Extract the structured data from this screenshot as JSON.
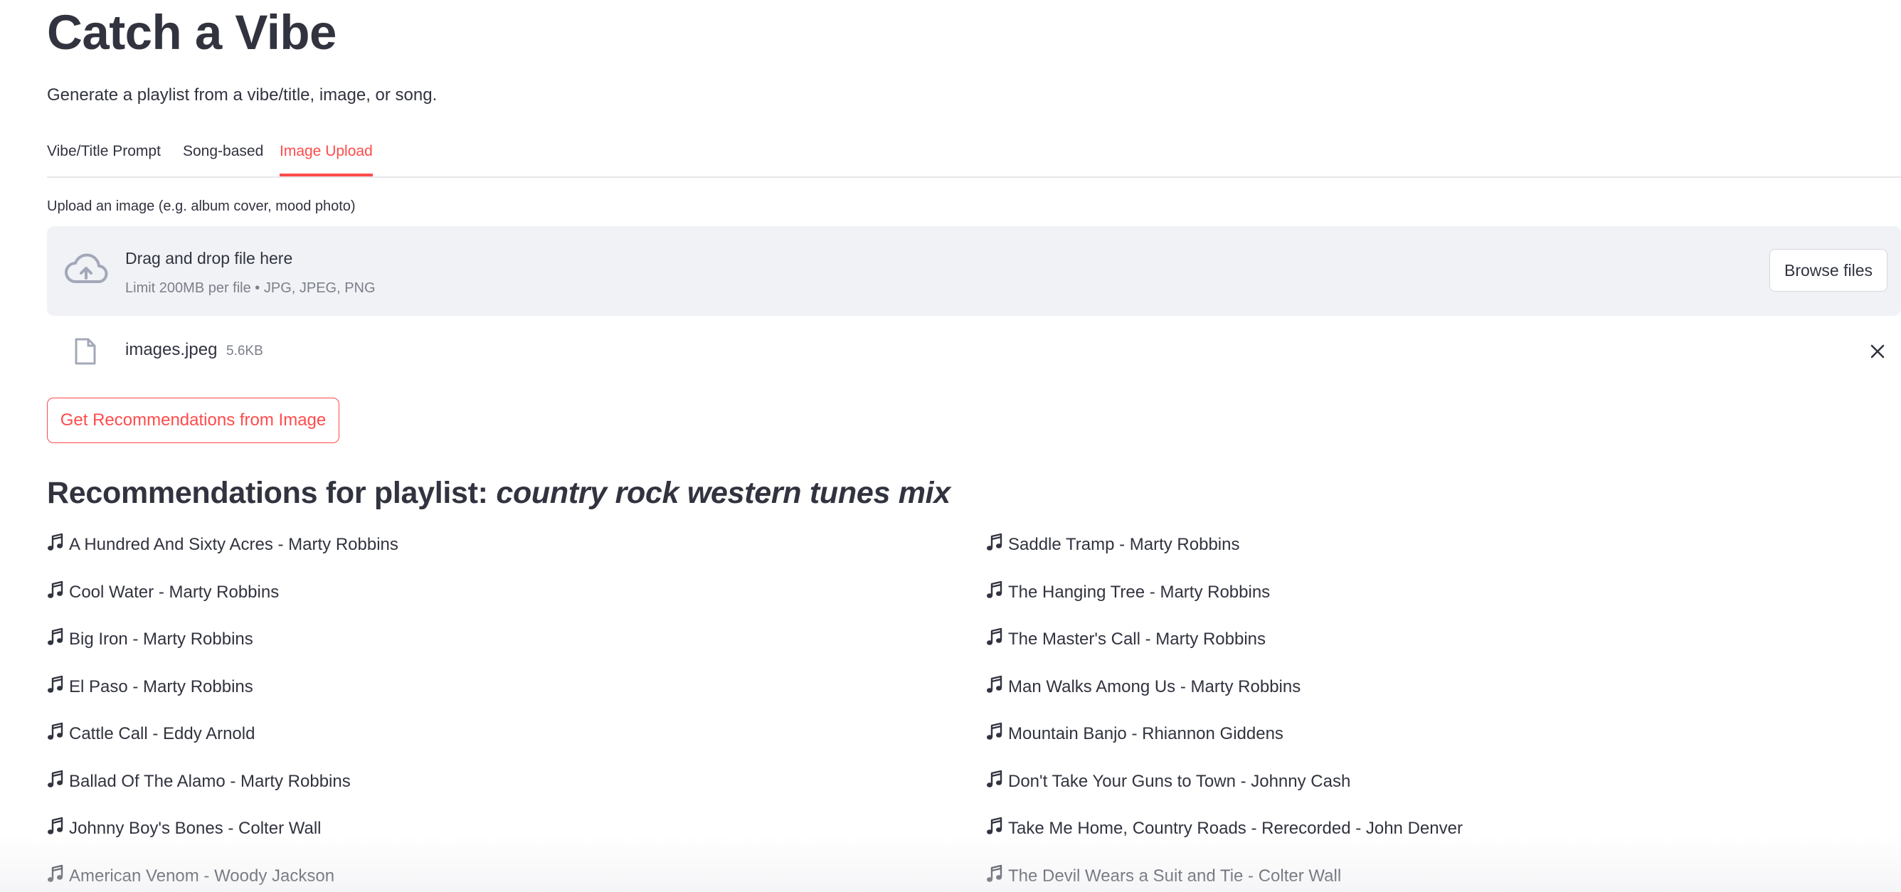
{
  "app": {
    "title": "Catch a Vibe",
    "subtitle": "Generate a playlist from a vibe/title, image, or song.",
    "accent_color": "#ff4b4b"
  },
  "tabs": [
    {
      "label": "Vibe/Title Prompt",
      "active": false
    },
    {
      "label": "Song-based",
      "active": false
    },
    {
      "label": "Image Upload",
      "active": true
    }
  ],
  "uploader": {
    "label": "Upload an image (e.g. album cover, mood photo)",
    "drop_title": "Drag and drop file here",
    "limit_text": "Limit 200MB per file • JPG, JPEG, PNG",
    "browse_label": "Browse files",
    "icon": "cloud-upload-icon"
  },
  "file": {
    "name": "images.jpeg",
    "size": "5.6KB",
    "icon": "file-icon",
    "remove_icon": "close-icon"
  },
  "actions": {
    "recommend_label": "Get Recommendations from Image"
  },
  "recommendations": {
    "heading_prefix": "Recommendations for playlist: ",
    "playlist_name": "country rock western tunes mix",
    "item_icon": "music-note-icon",
    "left": [
      "A Hundred And Sixty Acres - Marty Robbins",
      "Cool Water - Marty Robbins",
      "Big Iron - Marty Robbins",
      "El Paso - Marty Robbins",
      "Cattle Call - Eddy Arnold",
      "Ballad Of The Alamo - Marty Robbins",
      "Johnny Boy's Bones - Colter Wall",
      "American Venom - Woody Jackson"
    ],
    "right": [
      "Saddle Tramp - Marty Robbins",
      "The Hanging Tree - Marty Robbins",
      "The Master's Call - Marty Robbins",
      "Man Walks Among Us - Marty Robbins",
      "Mountain Banjo - Rhiannon Giddens",
      "Don't Take Your Guns to Town - Johnny Cash",
      "Take Me Home, Country Roads - Rerecorded - John Denver",
      "The Devil Wears a Suit and Tie - Colter Wall"
    ]
  }
}
